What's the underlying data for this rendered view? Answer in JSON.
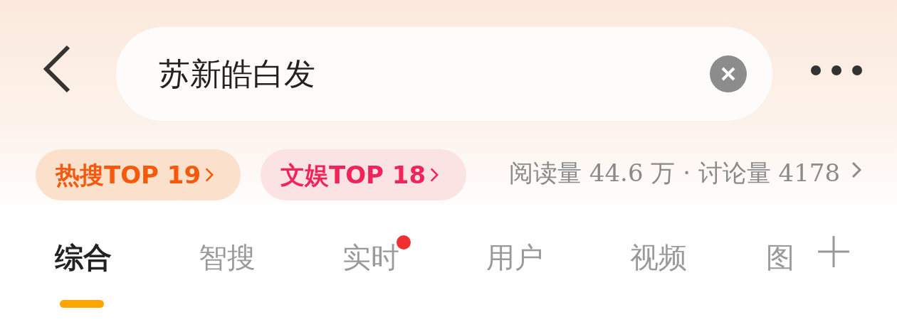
{
  "search": {
    "value": "苏新皓白发"
  },
  "badges": [
    {
      "label": "热搜TOP 19",
      "kind": "hot"
    },
    {
      "label": "文娱TOP 18",
      "kind": "ent"
    }
  ],
  "stats": "阅读量 44.6 万 · 讨论量 4178",
  "tabs": [
    {
      "label": "综合",
      "selected": true,
      "dot": false
    },
    {
      "label": "智搜",
      "selected": false,
      "dot": false
    },
    {
      "label": "实时",
      "selected": false,
      "dot": true
    },
    {
      "label": "用户",
      "selected": false,
      "dot": false
    },
    {
      "label": "视频",
      "selected": false,
      "dot": false
    },
    {
      "label": "图",
      "selected": false,
      "dot": false
    }
  ]
}
